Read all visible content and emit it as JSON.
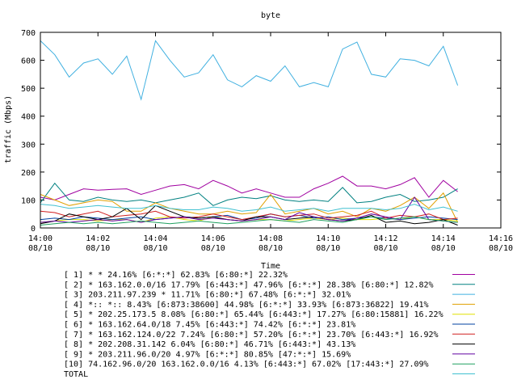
{
  "chart_data": {
    "type": "line",
    "title": "byte",
    "xlabel": "Time",
    "ylabel": "traffic (Mbps)",
    "ylim": [
      0,
      700
    ],
    "yticks": [
      "0",
      "100",
      "200",
      "300",
      "400",
      "500",
      "600",
      "700"
    ],
    "xticks": [
      {
        "time": "14:00",
        "date": "08/10"
      },
      {
        "time": "14:02",
        "date": "08/10"
      },
      {
        "time": "14:04",
        "date": "08/10"
      },
      {
        "time": "14:06",
        "date": "08/10"
      },
      {
        "time": "14:08",
        "date": "08/10"
      },
      {
        "time": "14:10",
        "date": "08/10"
      },
      {
        "time": "14:12",
        "date": "08/10"
      },
      {
        "time": "14:14",
        "date": "08/10"
      },
      {
        "time": "14:16",
        "date": "08/10"
      }
    ],
    "x_minutes": [
      0.0,
      0.5,
      1.0,
      1.5,
      2.0,
      2.5,
      3.0,
      3.5,
      4.0,
      4.5,
      5.0,
      5.5,
      6.0,
      6.5,
      7.0,
      7.5,
      8.0,
      8.5,
      9.0,
      9.5,
      10.0,
      10.5,
      11.0,
      11.5,
      12.0,
      12.5,
      13.0,
      13.5,
      14.0,
      14.5
    ],
    "series": [
      {
        "name": "[ 1] * * 24.16%  [6:*:*] 62.83% [6:80:*] 22.32%",
        "color": "#a000a0",
        "values": [
          110,
          100,
          120,
          140,
          135,
          138,
          140,
          120,
          135,
          150,
          155,
          140,
          170,
          150,
          125,
          140,
          125,
          110,
          110,
          140,
          160,
          185,
          150,
          150,
          140,
          155,
          180,
          110,
          170,
          130
        ]
      },
      {
        "name": "[ 2] * 163.162.0.0/16 17.79%  [6:443:*] 47.96% [6:*:*] 28.38% [6:80:*] 12.82%",
        "color": "#008080",
        "values": [
          90,
          160,
          100,
          95,
          110,
          100,
          95,
          100,
          90,
          100,
          110,
          125,
          80,
          100,
          110,
          105,
          115,
          100,
          95,
          100,
          95,
          145,
          90,
          95,
          110,
          120,
          95,
          100,
          110,
          140
        ]
      },
      {
        "name": "[ 3] 203.211.97.239 * 11.71%  [6:80:*] 67.48% [6:*:*] 32.01%",
        "color": "#40b0e0",
        "values": [
          670,
          620,
          540,
          590,
          605,
          550,
          615,
          460,
          670,
          600,
          540,
          555,
          620,
          530,
          505,
          545,
          525,
          580,
          505,
          520,
          505,
          640,
          665,
          550,
          540,
          605,
          600,
          580,
          650,
          510
        ]
      },
      {
        "name": "[ 4] *:: *:: 8.43%  [6:873:38600] 44.98% [6:*:*] 33.93% [6:873:36822] 19.41%",
        "color": "#e0a000",
        "values": [
          120,
          100,
          80,
          90,
          100,
          95,
          60,
          60,
          90,
          70,
          60,
          50,
          50,
          60,
          50,
          55,
          120,
          50,
          60,
          70,
          50,
          60,
          40,
          70,
          60,
          80,
          110,
          70,
          125,
          20
        ]
      },
      {
        "name": "[ 5] * 202.25.173.5 8.08%  [6:80:*] 65.44% [6:443:*] 17.27% [6:80:15881] 16.22%",
        "color": "#e0e000",
        "values": [
          20,
          25,
          30,
          30,
          25,
          30,
          30,
          20,
          35,
          40,
          30,
          25,
          40,
          30,
          25,
          30,
          30,
          25,
          30,
          35,
          30,
          35,
          30,
          30,
          35,
          30,
          40,
          30,
          30,
          25
        ]
      },
      {
        "name": "[ 6] * 163.162.64.0/18 7.45%  [6:443:*] 74.42% [6:*:*] 23.81%",
        "color": "#0040a0",
        "values": [
          30,
          35,
          30,
          40,
          35,
          30,
          35,
          40,
          30,
          35,
          40,
          35,
          40,
          45,
          30,
          35,
          50,
          40,
          45,
          35,
          40,
          30,
          35,
          40,
          35,
          30,
          35,
          40,
          35,
          30
        ]
      },
      {
        "name": "[ 7] * 163.162.124.0/22 7.24%  [6:80:*] 57.20% [6:*:*] 23.70% [6:443:*] 16.92%",
        "color": "#d02020",
        "values": [
          60,
          55,
          40,
          50,
          60,
          40,
          45,
          50,
          60,
          40,
          35,
          40,
          50,
          40,
          30,
          40,
          50,
          40,
          45,
          50,
          35,
          40,
          45,
          60,
          35,
          45,
          40,
          50,
          30,
          35
        ]
      },
      {
        "name": "[ 8] * 202.208.31.142 6.04%  [6:80:*] 46.71% [6:443:*] 43.13%",
        "color": "#000000",
        "values": [
          15,
          25,
          50,
          40,
          30,
          40,
          70,
          30,
          80,
          60,
          40,
          35,
          40,
          30,
          25,
          40,
          40,
          30,
          35,
          40,
          30,
          25,
          30,
          45,
          20,
          25,
          15,
          20,
          30,
          10
        ]
      },
      {
        "name": "[ 9] * 203.211.96.0/20 4.97%  [6:*:*] 80.85% [47:*:*] 15.69%",
        "color": "#6000a0",
        "values": [
          20,
          25,
          20,
          25,
          30,
          25,
          30,
          20,
          30,
          35,
          40,
          30,
          35,
          30,
          25,
          30,
          40,
          30,
          55,
          40,
          30,
          25,
          35,
          50,
          40,
          30,
          110,
          30,
          25,
          20
        ]
      },
      {
        "name": "[10] 74.162.96.0/20 163.162.0.0/16 4.13%  [6:443:*] 67.02% [17:443:*] 27.09%",
        "color": "#20a060",
        "values": [
          10,
          15,
          20,
          15,
          20,
          15,
          20,
          25,
          20,
          15,
          20,
          25,
          20,
          15,
          20,
          25,
          30,
          25,
          20,
          30,
          25,
          20,
          30,
          40,
          30,
          35,
          40,
          30,
          25,
          20
        ]
      },
      {
        "name": "TOTAL",
        "color": "#40c0d0",
        "values": [
          85,
          80,
          70,
          75,
          80,
          75,
          70,
          70,
          80,
          70,
          65,
          65,
          75,
          70,
          60,
          65,
          75,
          60,
          65,
          70,
          60,
          70,
          70,
          70,
          65,
          70,
          85,
          65,
          75,
          60
        ]
      }
    ]
  }
}
